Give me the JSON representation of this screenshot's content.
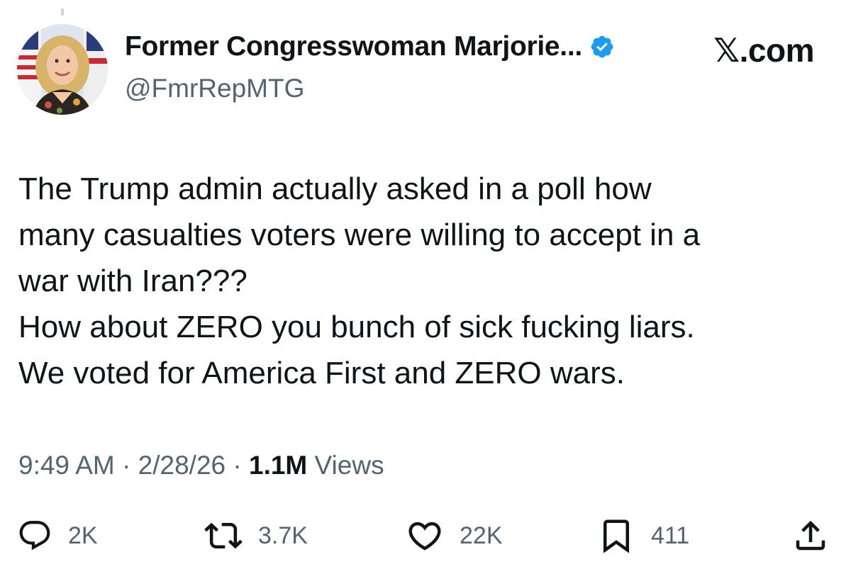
{
  "author": {
    "display_name": "Former Congresswoman Marjorie...",
    "handle": "@FmrRepMTG",
    "verified": true,
    "avatar": "profile-photo"
  },
  "brand": {
    "symbol": "𝕏",
    "suffix": ".com"
  },
  "tweet": {
    "lines": [
      "The Trump admin actually asked in a poll how",
      "many casualties voters were willing to accept in a",
      "war with Iran???",
      "How about ZERO you bunch of sick fucking liars.",
      "We voted for America First and ZERO wars."
    ]
  },
  "meta": {
    "time": "9:49 AM",
    "sep1": " · ",
    "date": "2/28/26",
    "sep2": " · ",
    "views_count": "1.1M",
    "views_label": " Views"
  },
  "actions": {
    "reply": {
      "icon": "reply-icon",
      "count": "2K"
    },
    "repost": {
      "icon": "repost-icon",
      "count": "3.7K"
    },
    "like": {
      "icon": "heart-icon",
      "count": "22K"
    },
    "bookmark": {
      "icon": "bookmark-icon",
      "count": "411"
    },
    "share": {
      "icon": "share-icon"
    }
  },
  "colors": {
    "text": "#0f1419",
    "secondary": "#536471",
    "verified": "#1d9bf0"
  }
}
